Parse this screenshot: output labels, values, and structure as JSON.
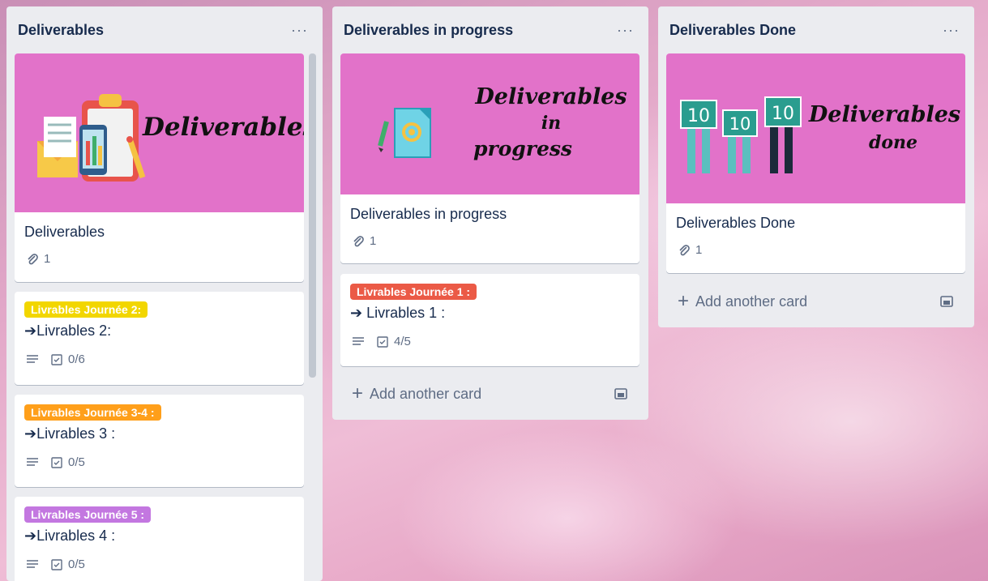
{
  "lists": [
    {
      "title": "Deliverables",
      "menu": "···",
      "cover_card": {
        "cover_text": "Deliverables",
        "title": "Deliverables",
        "attachments": "1"
      },
      "cards": [
        {
          "label": "Livrables Journée 2:",
          "label_color": "#f2d600",
          "title": "➔Livrables 2:",
          "checklist": "0/6"
        },
        {
          "label": "Livrables Journée 3-4 :",
          "label_color": "#ff9f1a",
          "title": "➔Livrables 3 :",
          "checklist": "0/5"
        },
        {
          "label": "Livrables Journée 5 :",
          "label_color": "#c377e0",
          "title": "➔Livrables 4 :",
          "checklist": "0/5"
        }
      ]
    },
    {
      "title": "Deliverables in progress",
      "menu": "···",
      "cover_card": {
        "cover_line1": "Deliverables",
        "cover_line2": "in",
        "cover_line3": "progress",
        "title": "Deliverables in progress",
        "attachments": "1"
      },
      "cards": [
        {
          "label": "Livrables Journée 1 :",
          "label_color": "#eb5a46",
          "title": "➔ Livrables 1 :",
          "checklist": "4/5"
        }
      ],
      "add_card": "Add another card"
    },
    {
      "title": "Deliverables Done",
      "menu": "···",
      "cover_card": {
        "cover_line1": "Deliverables",
        "cover_line2": "done",
        "sign_number": "10",
        "title": "Deliverables Done",
        "attachments": "1"
      },
      "add_card": "Add another card"
    }
  ],
  "colors": {
    "cover_bg": "#e272c9",
    "list_bg": "#ebecf0"
  },
  "icons": {
    "attachment": "paperclip-icon",
    "description": "description-icon",
    "checklist": "checklist-icon",
    "template": "card-template-icon",
    "menu": "more-icon"
  }
}
